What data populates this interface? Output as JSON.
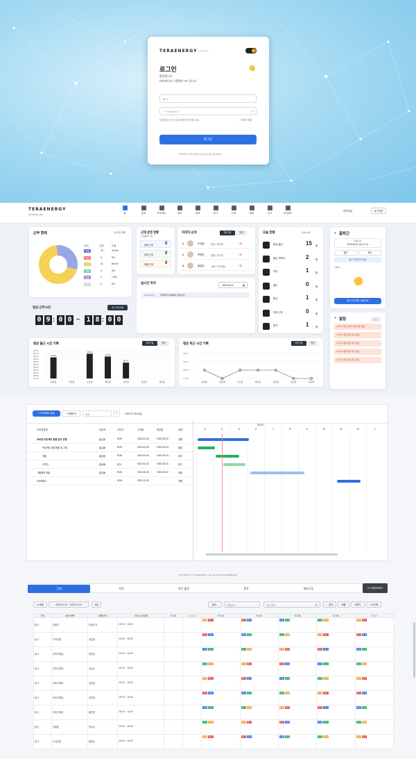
{
  "login": {
    "brand": "TERAENERGY",
    "brand_sub": "Groupware",
    "title": "로그인",
    "greeting": "환영합니다.",
    "desc": "테라에너지 그룹웨어 HR 입니다.",
    "id_value": "H",
    "pw_placeholder": "Password",
    "forgot": "비밀번호 찾기는 담당자에게 문의해주세요.",
    "remember": "아이디 저장",
    "submit": "로그인",
    "footer": "테라에너지 계정 변경 및 정보 관련 팀 사용 설명서"
  },
  "nav": {
    "brand": "TERAENERGY",
    "brand_sub": "Groupware HR",
    "items": [
      "홈",
      "일정",
      "프로젝트",
      "업무",
      "결재",
      "휴가",
      "근태",
      "채용",
      "인사",
      "관리업무"
    ],
    "user": "관리자님",
    "logout": "로그아웃"
  },
  "attendance_status": {
    "title": "근무 형태",
    "date": "2023년 6월",
    "headers": [
      "상태",
      "인원",
      "비율"
    ],
    "rows": [
      {
        "label": "정상",
        "count": "20",
        "pct": "33.3%",
        "color": "#5b6ad6"
      },
      {
        "label": "지각",
        "count": "0",
        "pct": "0%",
        "color": "#f36f6f"
      },
      {
        "label": "휴가",
        "count": "41",
        "pct": "66.1%",
        "color": "#f3c744"
      },
      {
        "label": "재택",
        "count": "0",
        "pct": "0%",
        "color": "#6ccf9a"
      },
      {
        "label": "출장",
        "count": "1",
        "pct": "1.6%",
        "color": "#b07ad8"
      },
      {
        "label": "조퇴",
        "count": "0",
        "pct": "0%",
        "color": "#cfd4db"
      }
    ]
  },
  "work_hours": {
    "title": "정상 근무시간",
    "button": "시간수정",
    "start": [
      "0",
      "9",
      "0",
      "0"
    ],
    "end": [
      "1",
      "8",
      "0",
      "0"
    ],
    "sep": "~"
  },
  "ops": {
    "title": "근태 운영 현황",
    "sub": "근태운영 기간",
    "rows": [
      {
        "label": "정상 근무",
        "value": "0"
      },
      {
        "label": "유연 근무",
        "value": "0"
      },
      {
        "label": "재량 근무",
        "value": "0"
      }
    ]
  },
  "ranking": {
    "title": "지각자 순위",
    "tab1": "최근7일",
    "tab2": "월간",
    "rows": [
      {
        "rank": "1",
        "name": "오성환",
        "dept": "대상 / 정지팀",
        "count": "1회"
      },
      {
        "rank": "2",
        "name": "조병찬",
        "dept": "영업 / 인사만",
        "count": "1회"
      },
      {
        "rank": "3",
        "name": "황정은",
        "dept": "사원 / 디자인팀",
        "count": "1회"
      }
    ]
  },
  "realtime": {
    "title": "실시간 위치",
    "date": "2023-06-21",
    "log_date": "2023-06-21",
    "log_text": "데이터가 존재하지 않습니다."
  },
  "today": {
    "title": "오늘 현황",
    "sub": "전체 67명",
    "rows": [
      {
        "label": "정상 출근",
        "value": "15",
        "unit": "명"
      },
      {
        "label": "출근 미체크",
        "value": "2",
        "unit": "명"
      },
      {
        "label": "지각",
        "value": "1",
        "unit": "명"
      },
      {
        "label": "결근",
        "value": "0",
        "unit": "명"
      },
      {
        "label": "퇴근",
        "value": "1",
        "unit": "명"
      },
      {
        "label": "초과 근무",
        "value": "0",
        "unit": "명"
      },
      {
        "label": "휴가",
        "value": "1",
        "unit": "명"
      }
    ]
  },
  "checkin": {
    "title": "출퇴근",
    "time_label": "현재시간",
    "date": "2023-06-21 (수) 17:11",
    "in": "출근",
    "out": "퇴근",
    "notice": "출근 체크를 하세요",
    "location": "나위치",
    "btn": "퇴근시간 하는 세상으로"
  },
  "alerts": {
    "title": "알림",
    "more": "더보기",
    "items": [
      "지각 1명 미처리 직원 확인 필요",
      "지각 서류 증빙 제출 필요",
      "지각 서류 증빙 제출 필요",
      "지각 서류 증빙 제출 필요",
      "지각 서류 증빙 제출 필요"
    ]
  },
  "avg_in": {
    "title": "평균 출근 시간 기록",
    "tab1": "최근7일",
    "tab2": "월간",
    "ylabels": [
      "09:30",
      "09:20",
      "09:10",
      "09:00",
      "08:50",
      "08:40",
      "08:30",
      "08:20",
      "08:10",
      "08:00",
      "07:50"
    ],
    "labels": [
      "월요일",
      "화요일",
      "수요일",
      "목요일",
      "금요일",
      "토요일",
      "일요일"
    ]
  },
  "avg_out": {
    "title": "평균 퇴근 시간 기록",
    "tab1": "최근7일",
    "tab2": "월간",
    "ylabels": [
      "18:20",
      "18:10",
      "18:00",
      "17:50"
    ],
    "labels": [
      "월요일",
      "화요일",
      "수요일",
      "목요일",
      "금요일",
      "토요일",
      "일요일"
    ]
  },
  "chart_data": [
    {
      "type": "bar",
      "title": "평균 출근 시간 기록",
      "categories": [
        "월요일",
        "화요일",
        "수요일",
        "목요일",
        "금요일",
        "토요일",
        "일요일"
      ],
      "values": [
        "09:06",
        "",
        "09:19",
        "09:09",
        "08:47",
        "",
        ""
      ],
      "ylim": [
        "07:50",
        "09:30"
      ]
    },
    {
      "type": "line",
      "title": "평균 퇴근 시간 기록",
      "categories": [
        "월요일",
        "화요일",
        "수요일",
        "목요일",
        "금요일",
        "토요일",
        "일요일"
      ],
      "values": [
        "18:00",
        "17:50",
        "18:00",
        "18:00",
        "18:00",
        "17:50",
        "17:50"
      ]
    }
  ],
  "copyright": "COPYRIGHT © TERAENERGY INC. ALL RIGHTS RESERVED.",
  "gantt": {
    "btn_add": "프로젝트 생성",
    "btn_filter": "전체추가",
    "search": "검색",
    "date": "2023-07-05 오늘",
    "year": "2022",
    "headers": [
      "프로젝트명",
      "담당자",
      "근무지",
      "시작일",
      "마감일",
      "상태"
    ],
    "months": [
      "3",
      "4",
      "5",
      "6",
      "7",
      "8",
      "9",
      "10",
      "11",
      "12",
      "1"
    ],
    "rows": [
      {
        "name": "AI비료 프로젝트 통합 업무 진행",
        "owner": "홍길동",
        "loc": "KDN",
        "start": "2022-02-03",
        "end": "2022-05-30",
        "status": "진행"
      },
      {
        "name": "프로젝트 제안계획 및 기획",
        "owner": "홍길동",
        "loc": "KDN",
        "start": "2022-02-03",
        "end": "2022-03-03",
        "status": "완료"
      },
      {
        "name": "개발",
        "owner": "홍길동",
        "loc": "KDN",
        "start": "2022-04-04",
        "end": "2022-05-13",
        "status": "대기"
      },
      {
        "name": "디자인",
        "owner": "홍길동",
        "loc": "본사",
        "start": "2022-04-22",
        "end": "2022-05-30",
        "status": "대기"
      },
      {
        "name": "그룹웨어 개발",
        "owner": "홍길동",
        "loc": "KDN",
        "start": "2022-06-20",
        "end": "2022-09-30",
        "status": "계획"
      },
      {
        "name": "프로젝트2",
        "owner": "",
        "loc": "KDN",
        "start": "2022-12-20",
        "end": "",
        "status": "진행"
      }
    ]
  },
  "att": {
    "tabs": [
      "근태",
      "지각",
      "퇴근 출장",
      "휴가",
      "외부근무"
    ],
    "btn": "근태관리하기",
    "range": "2023-07-01 ~ 2023-07-15",
    "today": "오늘",
    "filter1": "본사",
    "search_ph": "이름검색",
    "date_ph": "기간 선택",
    "btns": [
      "검색",
      "엑셀",
      "더보기",
      "초기화"
    ],
    "headers": [
      "근무",
      "부서/직책",
      "이름/근무",
      "근무시간/유형",
      "07-01",
      "07-02",
      "07-03",
      "07-04",
      "07-05",
      "07-06",
      "07-07"
    ],
    "rows": [
      {
        "loc": "본사",
        "dept": "임원진",
        "name": "대표이사",
        "time": "09:00 ~ 18:00"
      },
      {
        "loc": "본사",
        "dept": "디자인팀",
        "name": "최은영",
        "time": "09:00 ~ 18:00"
      },
      {
        "loc": "본사",
        "dept": "전략기획팀",
        "name": "박성진",
        "time": "09:00 ~ 18:00"
      },
      {
        "loc": "본사",
        "dept": "전략기획팀",
        "name": "김승수",
        "time": "09:00 ~ 18:00"
      },
      {
        "loc": "본사",
        "dept": "전략기획팀",
        "name": "김민정",
        "time": "09:00 ~ 18:00"
      },
      {
        "loc": "본사",
        "dept": "전략기획팀",
        "name": "오민정",
        "time": "09:00 ~ 18:00"
      },
      {
        "loc": "본사",
        "dept": "전략기획팀",
        "name": "황민진",
        "time": "09:00 ~ 18:00"
      },
      {
        "loc": "본사",
        "dept": "개발팀",
        "name": "박상수",
        "time": "09:00 ~ 18:00"
      },
      {
        "loc": "본사",
        "dept": "디자인팀",
        "name": "황영수",
        "time": "09:00 ~ 18:00"
      }
    ]
  }
}
